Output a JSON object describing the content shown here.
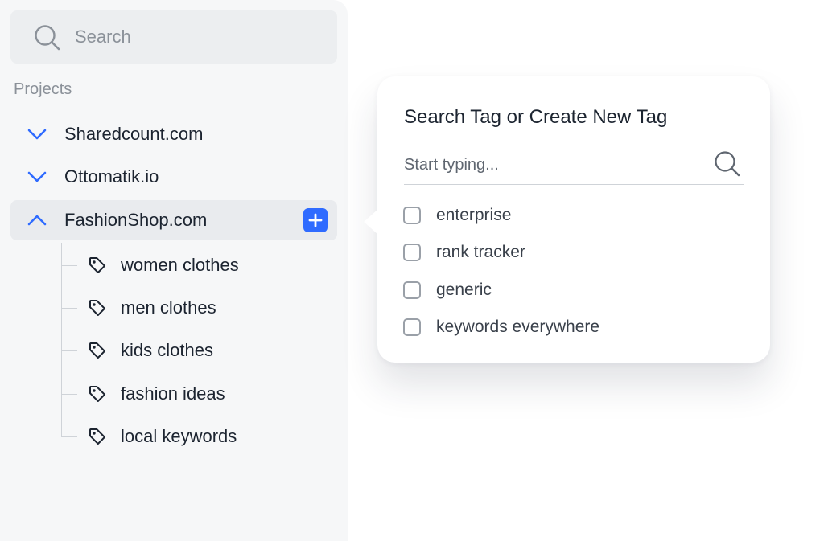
{
  "sidebar": {
    "search": {
      "placeholder": "Search",
      "icon": "search-icon"
    },
    "section_label": "Projects",
    "projects": [
      {
        "label": "Sharedcount.com",
        "expanded": false,
        "icon": "chevron-down-icon"
      },
      {
        "label": "Ottomatik.io",
        "expanded": false,
        "icon": "chevron-down-icon"
      },
      {
        "label": "FashionShop.com",
        "expanded": true,
        "icon": "chevron-up-icon"
      }
    ],
    "active_project_add_icon": "plus-icon",
    "tags": [
      {
        "label": "women clothes",
        "icon": "tag-icon"
      },
      {
        "label": "men clothes",
        "icon": "tag-icon"
      },
      {
        "label": "kids clothes",
        "icon": "tag-icon"
      },
      {
        "label": "fashion ideas",
        "icon": "tag-icon"
      },
      {
        "label": "local keywords",
        "icon": "tag-icon"
      }
    ]
  },
  "popover": {
    "title": "Search Tag or Create New Tag",
    "input": {
      "placeholder": "Start typing...",
      "value": ""
    },
    "options": [
      {
        "label": "enterprise",
        "checked": false
      },
      {
        "label": "rank tracker",
        "checked": false
      },
      {
        "label": "generic",
        "checked": false
      },
      {
        "label": "keywords everywhere",
        "checked": false
      }
    ]
  },
  "colors": {
    "accent": "#2f6bff",
    "sidebar_bg": "#f6f7f8",
    "active_row_bg": "#e9ebee",
    "text_primary": "#1c2430",
    "text_muted": "#8b9199"
  }
}
